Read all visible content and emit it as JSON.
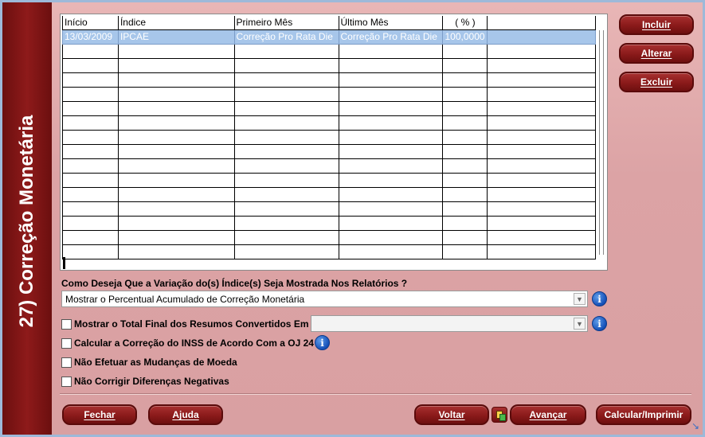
{
  "sidebar": {
    "title": "27) Correção Monetária"
  },
  "grid": {
    "columns": [
      "Início",
      "Índice",
      "Primeiro Mês",
      "Último Mês",
      "( % )"
    ],
    "rows": [
      [
        "13/03/2009",
        "IPCAE",
        "Correção Pro Rata Die",
        "Correção Pro Rata Die",
        "100,0000"
      ]
    ],
    "empty_row_count": 15
  },
  "actions": {
    "incluir": "Incluir",
    "alterar": "Alterar",
    "excluir": "Excluir"
  },
  "form": {
    "question": "Como Deseja Que a Variação do(s) Índice(s) Seja Mostrada Nos Relatórios ?",
    "display_mode_value": "Mostrar o Percentual Acumulado de Correção Monetária",
    "show_total_label": "Mostrar o Total Final dos Resumos Convertidos Em",
    "show_total_value": "",
    "inss_label": "Calcular a Correção do INSS de Acordo Com a OJ 24",
    "no_currency_label": "Não Efetuar as Mudanças de Moeda",
    "no_negative_label": "Não Corrigir Diferenças Negativas"
  },
  "footer": {
    "fechar": "Fechar",
    "ajuda": "Ajuda",
    "voltar": "Voltar",
    "avancar": "Avançar",
    "calcular": "Calcular/Imprimir"
  },
  "icons": {
    "info": "info-icon",
    "resize": "resize-grip-icon"
  },
  "colors": {
    "sidebar": "#8e1a1a",
    "button": "#8a1a1a",
    "selected_row": "#a7c6ea"
  }
}
